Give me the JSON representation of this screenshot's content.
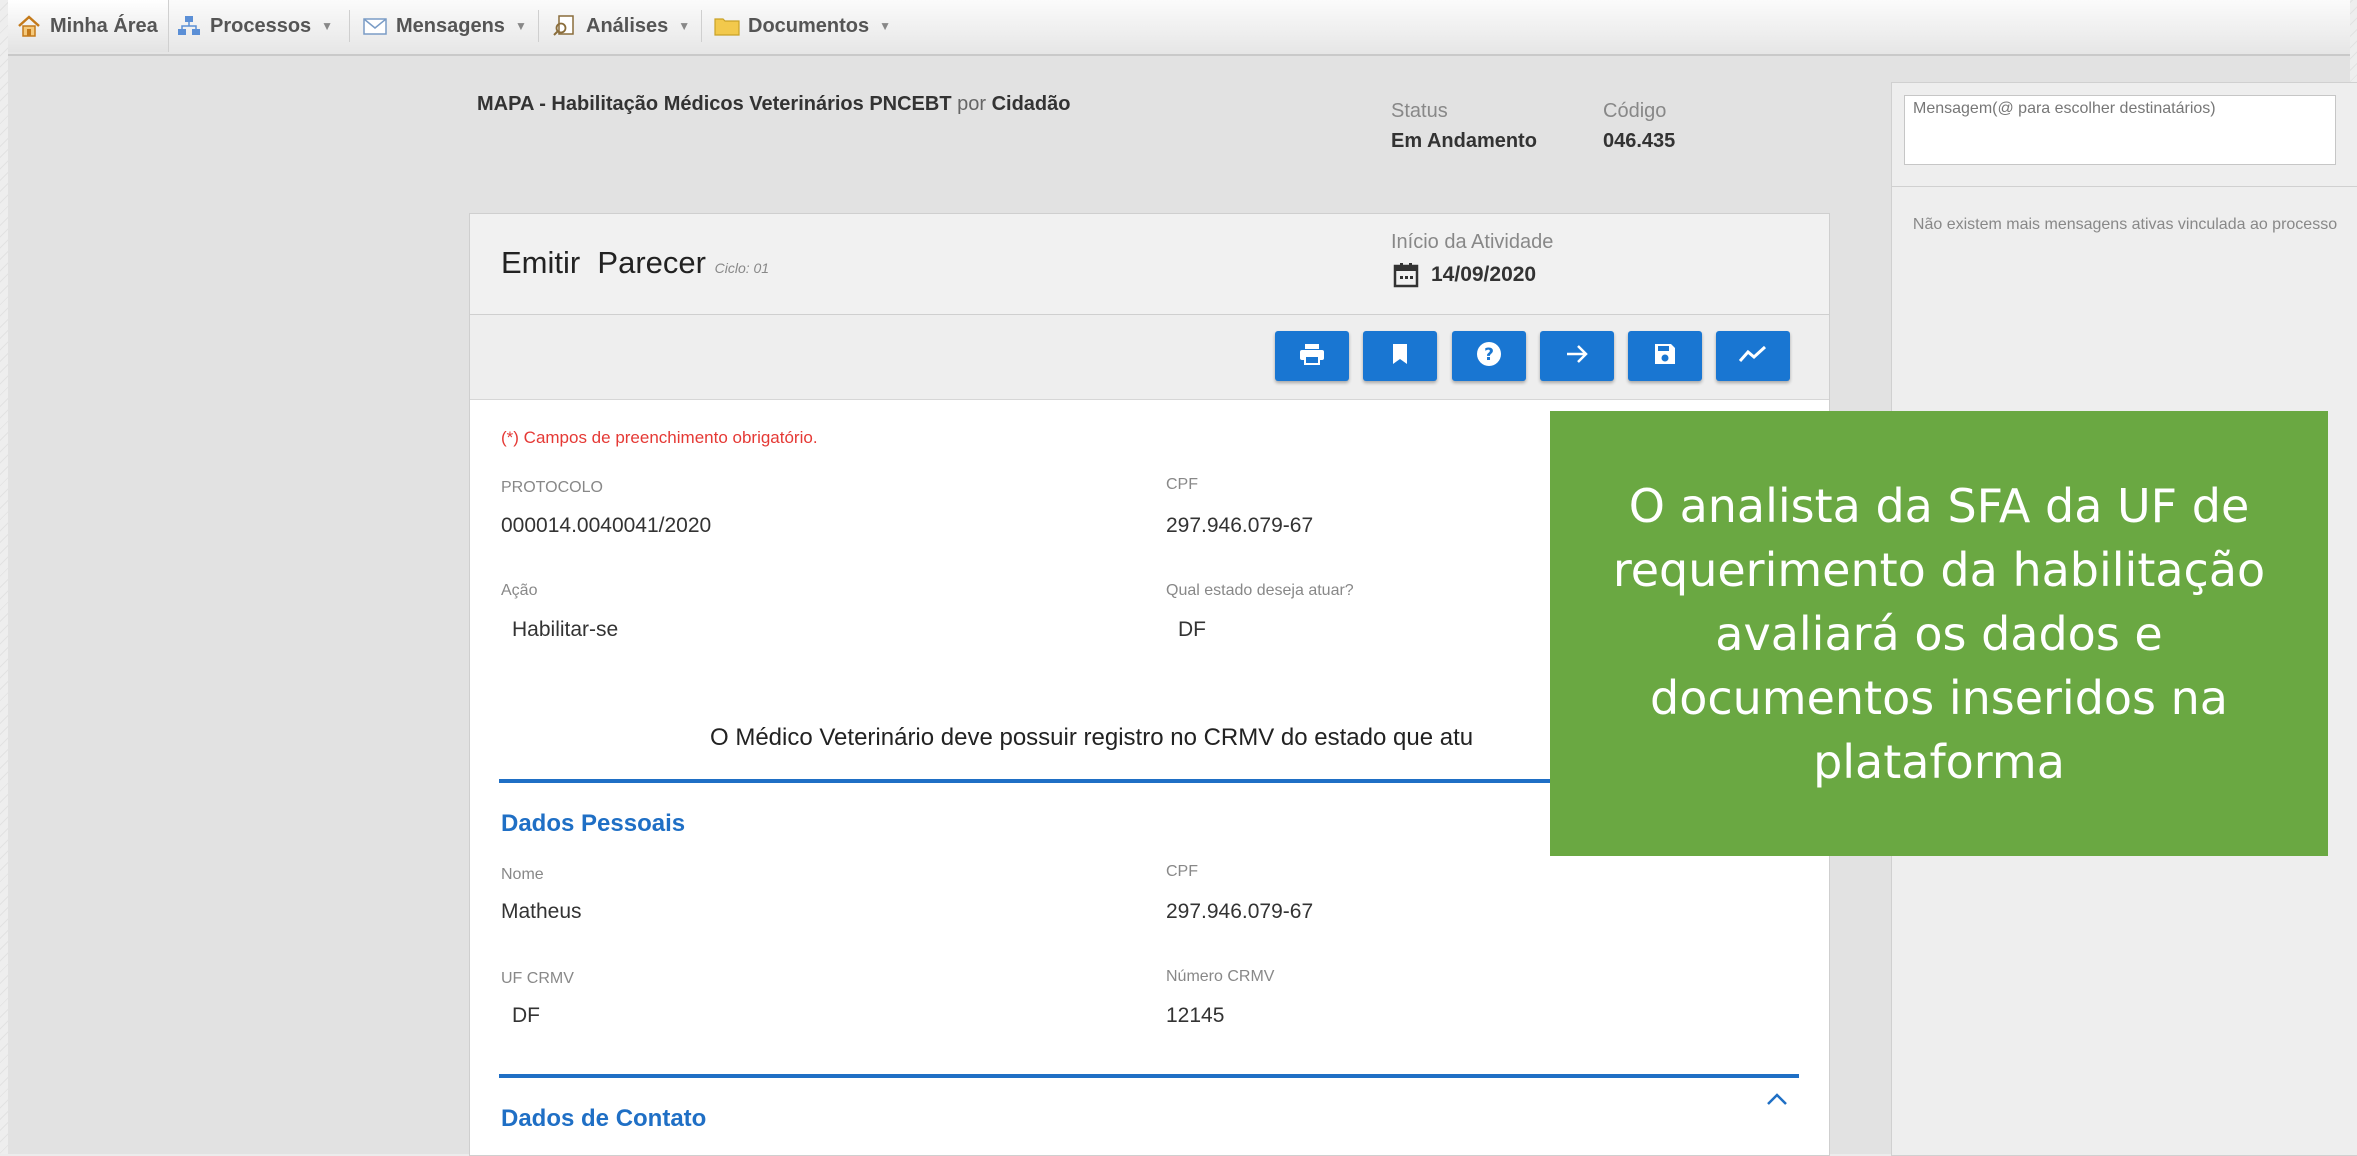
{
  "menu": {
    "items": [
      {
        "label": "Minha Área",
        "icon": "home-icon"
      },
      {
        "label": "Processos",
        "icon": "sitemap-icon"
      },
      {
        "label": "Mensagens",
        "icon": "envelope-icon"
      },
      {
        "label": "Análises",
        "icon": "search-document-icon"
      },
      {
        "label": "Documentos",
        "icon": "folder-icon"
      }
    ]
  },
  "process": {
    "title": "MAPA - Habilitação Médicos Veterinários PNCEBT",
    "por": "por",
    "author": "Cidadão",
    "status_label": "Status",
    "status_value": "Em Andamento",
    "code_label": "Código",
    "code_value": "046.435"
  },
  "activity": {
    "title": "Emitir  Parecer",
    "cycle": "Ciclo: 01",
    "start_label": "Início da Atividade",
    "start_date": "14/09/2020"
  },
  "toolbar": {
    "buttons": [
      "print-icon",
      "bookmark-icon",
      "help-icon",
      "arrow-right-icon",
      "save-icon",
      "chart-line-icon"
    ],
    "accent": "#1976d2"
  },
  "form": {
    "required_note": "(*) Campos de preenchimento obrigatório.",
    "protocolo_label": "PROTOCOLO",
    "protocolo_value": "000014.0040041/2020",
    "cpf_label": "CPF",
    "cpf_value": "297.946.079-67",
    "acao_label": "Ação",
    "acao_value": "Habilitar-se",
    "estado_label": "Qual estado deseja atuar?",
    "estado_value": "DF",
    "notice": "O Médico Veterinário deve possuir registro no CRMV do estado que atu"
  },
  "dados_pessoais": {
    "title": "Dados Pessoais",
    "nome_label": "Nome",
    "nome_value": "Matheus",
    "cpf_label": "CPF",
    "cpf_value": "297.946.079-67",
    "uf_label": "UF CRMV",
    "uf_value": "DF",
    "numero_label": "Número CRMV",
    "numero_value": "12145"
  },
  "dados_contato": {
    "title": "Dados de Contato"
  },
  "messages": {
    "placeholder": "Mensagem(@ para escolher destinatários)",
    "empty": "Não existem mais mensagens ativas vinculada ao processo"
  },
  "overlay": {
    "text": "O analista da SFA da UF de requerimento  da habilitação avaliará os dados e  documentos inseridos na plataforma",
    "color": "#6aa842"
  }
}
